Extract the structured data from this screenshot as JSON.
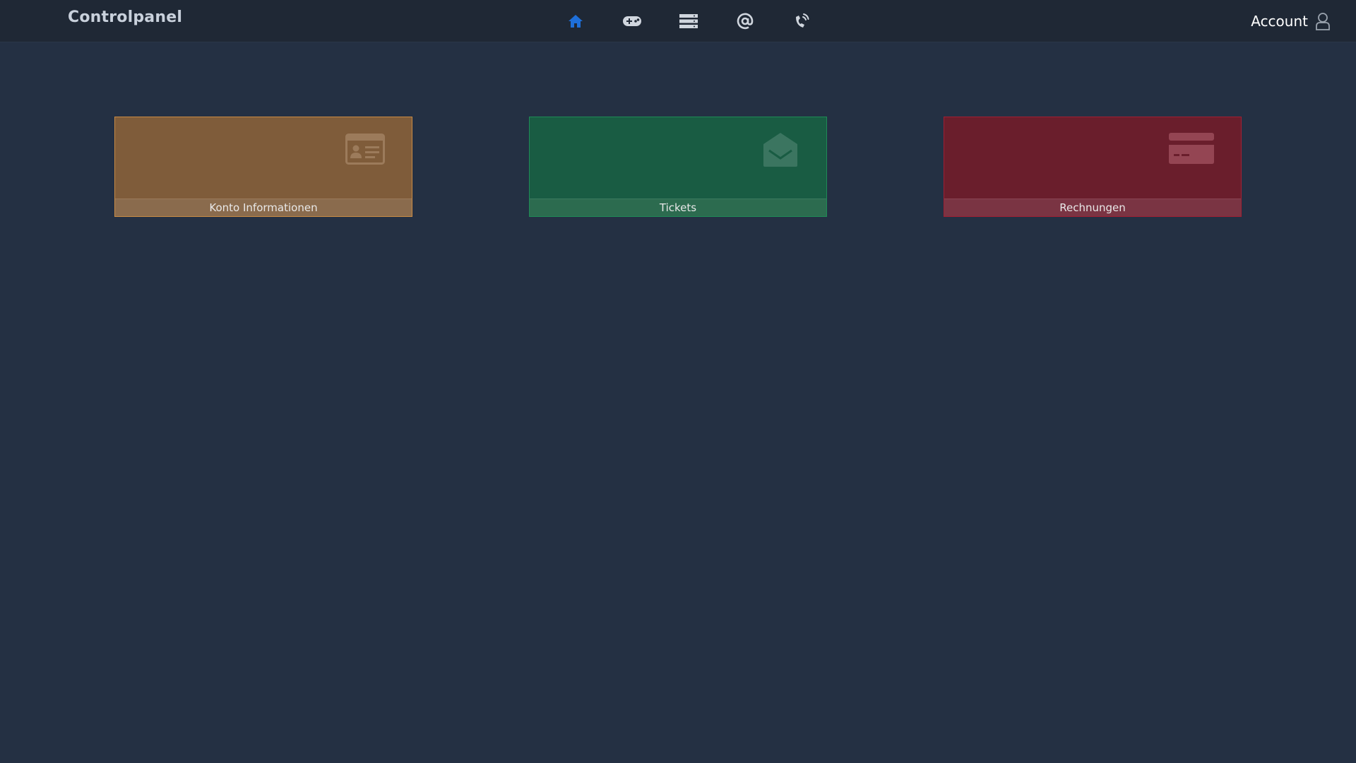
{
  "header": {
    "brand": "Controlpanel",
    "nav": [
      {
        "icon": "home-icon",
        "active": true
      },
      {
        "icon": "gamepad-icon",
        "active": false
      },
      {
        "icon": "server-icon",
        "active": false
      },
      {
        "icon": "at-sign-icon",
        "active": false
      },
      {
        "icon": "phone-ringing-icon",
        "active": false
      }
    ],
    "account_label": "Account",
    "account_icon": "user-icon"
  },
  "tiles": [
    {
      "label": "Konto Informationen",
      "icon": "id-card-icon",
      "color": "#7f5c3a"
    },
    {
      "label": "Tickets",
      "icon": "envelope-open-icon",
      "color": "#195c43"
    },
    {
      "label": "Rechnungen",
      "icon": "credit-card-icon",
      "color": "#6a1e2c"
    }
  ],
  "colors": {
    "background": "#243043",
    "topbar": "#1f2835",
    "nav_active": "#1e6fd9",
    "nav_inactive": "#d0d6de"
  }
}
